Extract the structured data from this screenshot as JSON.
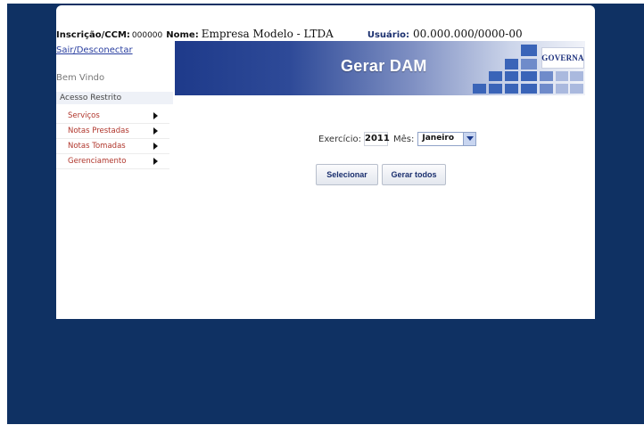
{
  "header": {
    "inscricao_label": "Inscrição/CCM:",
    "inscricao_value": "000000",
    "nome_label": "Nome:",
    "nome_value": "Empresa Modelo - LTDA",
    "usuario_label": "Usuário:",
    "usuario_value": "00.000.000/0000-00",
    "logout_link": "Sair/Desconectar",
    "welcome": "Bem Vindo"
  },
  "banner": {
    "title": "Gerar DAM",
    "logo_text": "GOVERNA"
  },
  "sidebar": {
    "header": "Acesso Restrito",
    "items": [
      {
        "label": "Serviços"
      },
      {
        "label": "Notas Prestadas"
      },
      {
        "label": "Notas Tomadas"
      },
      {
        "label": "Gerenciamento"
      }
    ]
  },
  "form": {
    "exercicio_label": "Exercício:",
    "exercicio_value": "2011",
    "mes_label": "Mês:",
    "mes_value": "Janeiro",
    "select_button": "Selecionar",
    "generate_all_button": "Gerar todos"
  },
  "colors": {
    "background_navy": "#0f3163",
    "menu_text": "#b0362c",
    "banner_blue": "#1e3a8a"
  }
}
